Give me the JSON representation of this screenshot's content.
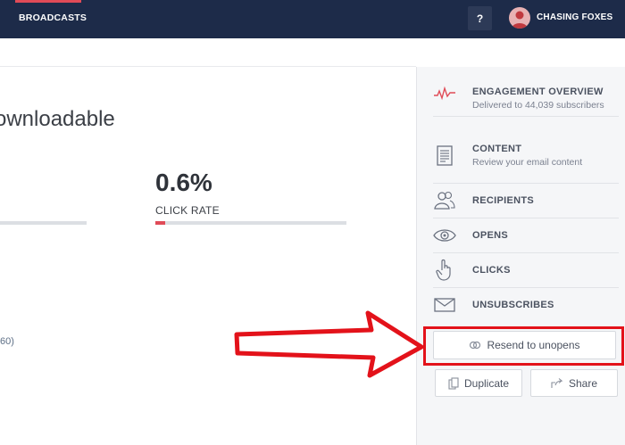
{
  "header": {
    "nav_broadcasts": "BROADCASTS",
    "help_label": "?",
    "account_name": "CHASING FOXES"
  },
  "main": {
    "title": "ownloadable",
    "metric": {
      "value": "0.6%",
      "label": "CLICK RATE",
      "fill_fraction": 0.05
    },
    "link_fragment": "60)"
  },
  "sidebar": {
    "items": [
      {
        "title": "ENGAGEMENT OVERVIEW",
        "subtitle": "Delivered to 44,039 subscribers",
        "icon": "activity-chart-icon"
      },
      {
        "title": "CONTENT",
        "subtitle": "Review your email content",
        "icon": "document-icon"
      },
      {
        "title": "RECIPIENTS",
        "icon": "users-icon"
      },
      {
        "title": "OPENS",
        "icon": "eye-icon"
      },
      {
        "title": "CLICKS",
        "icon": "hand-pointer-icon"
      },
      {
        "title": "UNSUBSCRIBES",
        "icon": "envelope-icon"
      }
    ],
    "resend_label": "Resend to unopens",
    "duplicate_label": "Duplicate",
    "share_label": "Share"
  },
  "colors": {
    "topbar": "#1d2b49",
    "accent": "#e04b57",
    "annotation": "#e3121a",
    "sidebar_bg": "#f5f6f8"
  }
}
